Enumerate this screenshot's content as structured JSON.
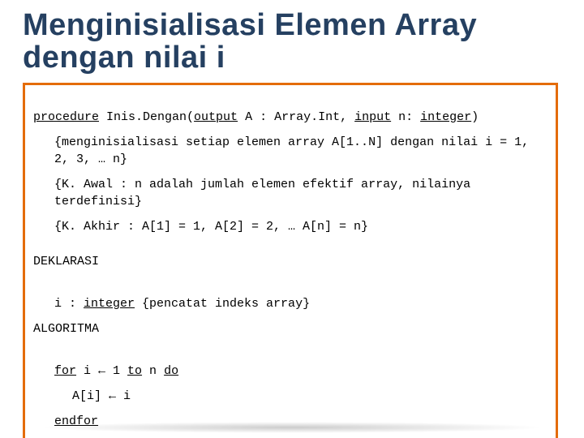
{
  "title": "Menginisialisasi Elemen Array dengan nilai i",
  "sig": {
    "kw_procedure": "procedure",
    "name": " Inis.Dengan(",
    "kw_output": "output",
    "after_output": " A : Array.Int, ",
    "kw_input": "input",
    "after_input": " n: ",
    "kw_integer": "integer",
    "close": ")"
  },
  "desc1": "{menginisialisasi setiap elemen array A[1..N] dengan nilai i = 1, 2, 3, … n}",
  "desc2": "{K. Awal : n adalah jumlah elemen efektif array, nilainya terdefinisi}",
  "desc3": "{K. Akhir : A[1] = 1, A[2] = 2, … A[n] = n}",
  "deklarasi_label": "DEKLARASI",
  "dekl_line": {
    "pre": "i : ",
    "kw_integer": "integer",
    "post": " {pencatat indeks array}"
  },
  "algoritma_label": "ALGORITMA",
  "for_line": {
    "kw_for": "for",
    "mid1": " i ← 1 ",
    "kw_to": "to",
    "mid2": " n ",
    "kw_do": "do"
  },
  "body_line": "A[i] ← i",
  "endfor": "endfor"
}
